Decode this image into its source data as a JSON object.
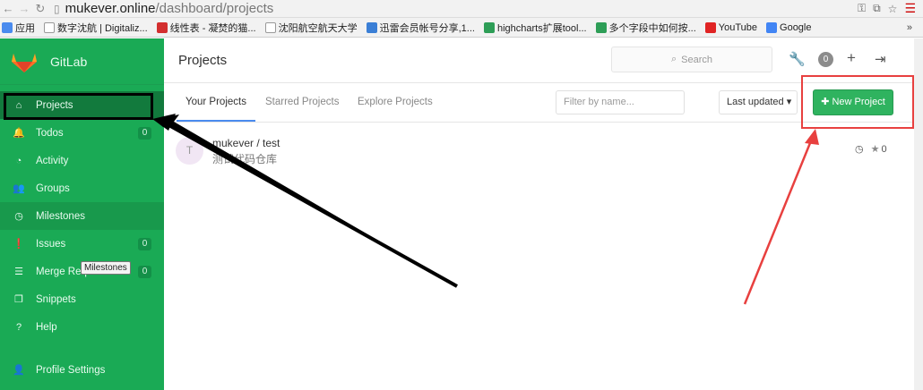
{
  "browser": {
    "url_host": "mukever.online",
    "url_path": "/dashboard/projects",
    "bookmarks": [
      {
        "label": "应用",
        "icon": "apps-icon",
        "color": "#4a8bee"
      },
      {
        "label": "数字沈航 | Digitaliz...",
        "icon": "site-icon",
        "color": "#ffffff"
      },
      {
        "label": "线性表 - 凝焚的猫...",
        "icon": "c-icon",
        "color": "#d32f2f"
      },
      {
        "label": "沈阳航空航天大学",
        "icon": "page-icon",
        "color": "#ffffff"
      },
      {
        "label": "迅雷会员帐号分享,1...",
        "icon": "xunlei-icon",
        "color": "#3b7fd6"
      },
      {
        "label": "highcharts扩展tool...",
        "icon": "c-icon",
        "color": "#2e9e57"
      },
      {
        "label": "多个字段中如何按...",
        "icon": "c-icon",
        "color": "#2e9e57"
      },
      {
        "label": "YouTube",
        "icon": "youtube-icon",
        "color": "#e02424"
      },
      {
        "label": "Google",
        "icon": "google-icon",
        "color": "#4285f4"
      }
    ],
    "bookmarks_more": "»"
  },
  "sidebar": {
    "brand": "GitLab",
    "items": [
      {
        "label": "Projects",
        "icon": "home-icon",
        "glyph": "⌂",
        "count": "",
        "state": "active"
      },
      {
        "label": "Todos",
        "icon": "bell-icon",
        "glyph": "🔔",
        "count": "0",
        "state": ""
      },
      {
        "label": "Activity",
        "icon": "dashboard-icon",
        "glyph": "◔",
        "count": "",
        "state": ""
      },
      {
        "label": "Groups",
        "icon": "users-icon",
        "glyph": "👥",
        "count": "",
        "state": ""
      },
      {
        "label": "Milestones",
        "icon": "clock-icon",
        "glyph": "◷",
        "count": "",
        "state": "hover"
      },
      {
        "label": "Issues",
        "icon": "issue-icon",
        "glyph": "❗",
        "count": "0",
        "state": ""
      },
      {
        "label": "Merge Requests",
        "icon": "merge-icon",
        "glyph": "☰",
        "count": "0",
        "state": ""
      },
      {
        "label": "Snippets",
        "icon": "snippet-icon",
        "glyph": "❐",
        "count": "",
        "state": ""
      },
      {
        "label": "Help",
        "icon": "help-icon",
        "glyph": "?",
        "count": "",
        "state": ""
      }
    ],
    "bottom_item": {
      "label": "Profile Settings",
      "icon": "user-icon",
      "glyph": "👤"
    },
    "tooltip": "Milestones"
  },
  "header": {
    "title": "Projects",
    "search_placeholder": "Search",
    "todo_count": "0"
  },
  "tabs": {
    "items": [
      "Your Projects",
      "Starred Projects",
      "Explore Projects"
    ],
    "filter_placeholder": "Filter by name...",
    "sort_label": "Last updated",
    "new_project": "New Project"
  },
  "project": {
    "initial": "T",
    "name": "mukever / test",
    "description": "测试代码仓库",
    "stars": "0"
  }
}
